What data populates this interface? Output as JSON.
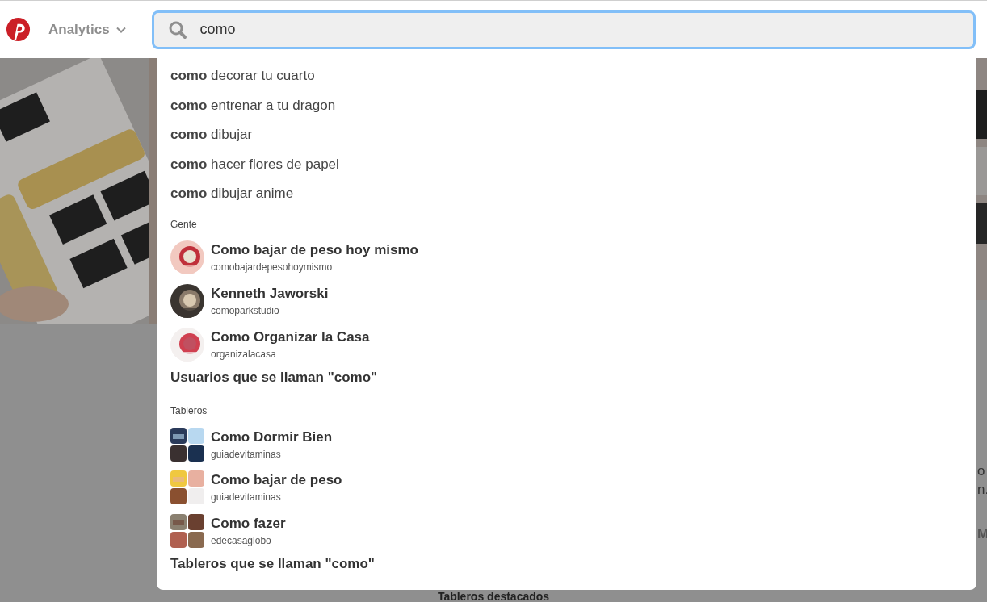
{
  "header": {
    "menu_label": "Analytics"
  },
  "search": {
    "value": "como"
  },
  "suggestions": [
    "**como** decorar tu cuarto",
    "**como** entrenar a tu dragon",
    "**como** dibujar",
    "**como** hacer flores de papel",
    "**como** dibujar anime"
  ],
  "people": {
    "title": "Gente",
    "items": [
      {
        "name": "Como bajar de peso hoy mismo",
        "handle": "comobajardepesohoymismo"
      },
      {
        "name": "Kenneth Jaworski",
        "handle": "comoparkstudio"
      },
      {
        "name": "Como Organizar la Casa",
        "handle": "organizalacasa"
      }
    ],
    "more": "Usuarios que se llaman \"como\""
  },
  "boards": {
    "title": "Tableros",
    "items": [
      {
        "name": "Como Dormir Bien",
        "handle": "guiadevitaminas"
      },
      {
        "name": "Como bajar de peso",
        "handle": "guiadevitaminas"
      },
      {
        "name": "Como fazer",
        "handle": "edecasaglobo"
      }
    ],
    "more": "Tableros que se llaman \"como\""
  },
  "background": {
    "heading": "Tableros destacados",
    "fragments": [
      "o",
      "n.",
      "M"
    ]
  }
}
